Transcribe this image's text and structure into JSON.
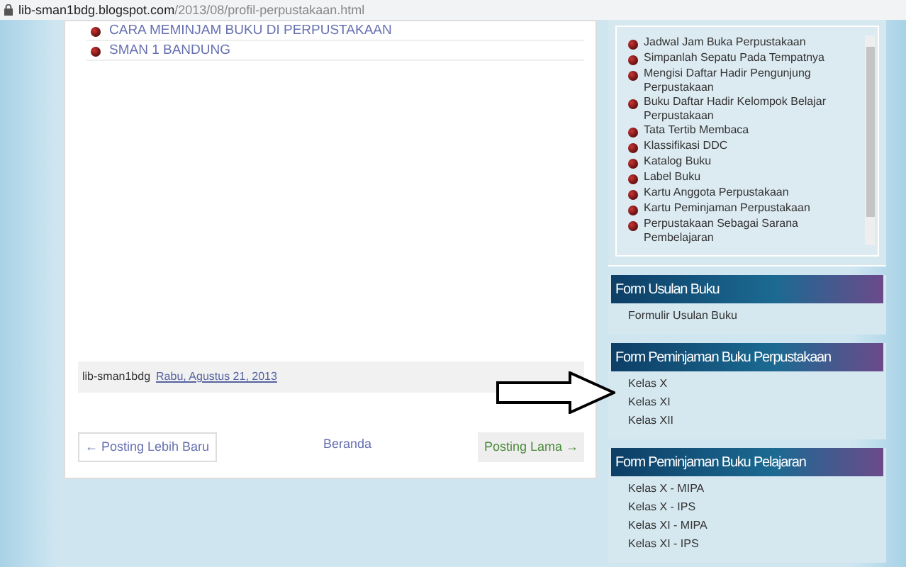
{
  "address_bar": {
    "host": "lib-sman1bdg.blogspot.com",
    "path": "/2013/08/profil-perpustakaan.html"
  },
  "post_links": [
    "CARA MEMINJAM BUKU DI PERPUSTAKAAN",
    "SMAN 1 BANDUNG"
  ],
  "post_footer": {
    "author": "lib-sman1bdg",
    "date": "Rabu, Agustus 21, 2013"
  },
  "pager": {
    "newer": "← Posting Lebih Baru",
    "home": "Beranda",
    "older": "Posting Lama →"
  },
  "sidebar": {
    "link_list": [
      "Jadwal Jam Buka Perpustakaan",
      "Simpanlah Sepatu Pada Tempatnya",
      "Mengisi Daftar Hadir Pengunjung Perpustakaan",
      "Buku Daftar Hadir Kelompok Belajar Perpustakaan",
      "Tata Tertib Membaca",
      "Klassifikasi DDC",
      "Katalog Buku",
      "Label Buku",
      "Kartu Anggota Perpustakaan",
      "Kartu Peminjaman Perpustakaan",
      "Perpustakaan Sebagai Sarana Pembelajaran"
    ],
    "widgets": [
      {
        "title": "Form Usulan Buku",
        "links": [
          "Formulir Usulan Buku"
        ]
      },
      {
        "title": "Form Peminjaman Buku Perpustakaan",
        "links": [
          "Kelas X",
          "Kelas XI",
          "Kelas XII"
        ]
      },
      {
        "title": "Form Peminjaman Buku Pelajaran",
        "links": [
          "Kelas X - MIPA",
          "Kelas X - IPS",
          "Kelas XI - MIPA",
          "Kelas XI - IPS"
        ]
      }
    ]
  }
}
